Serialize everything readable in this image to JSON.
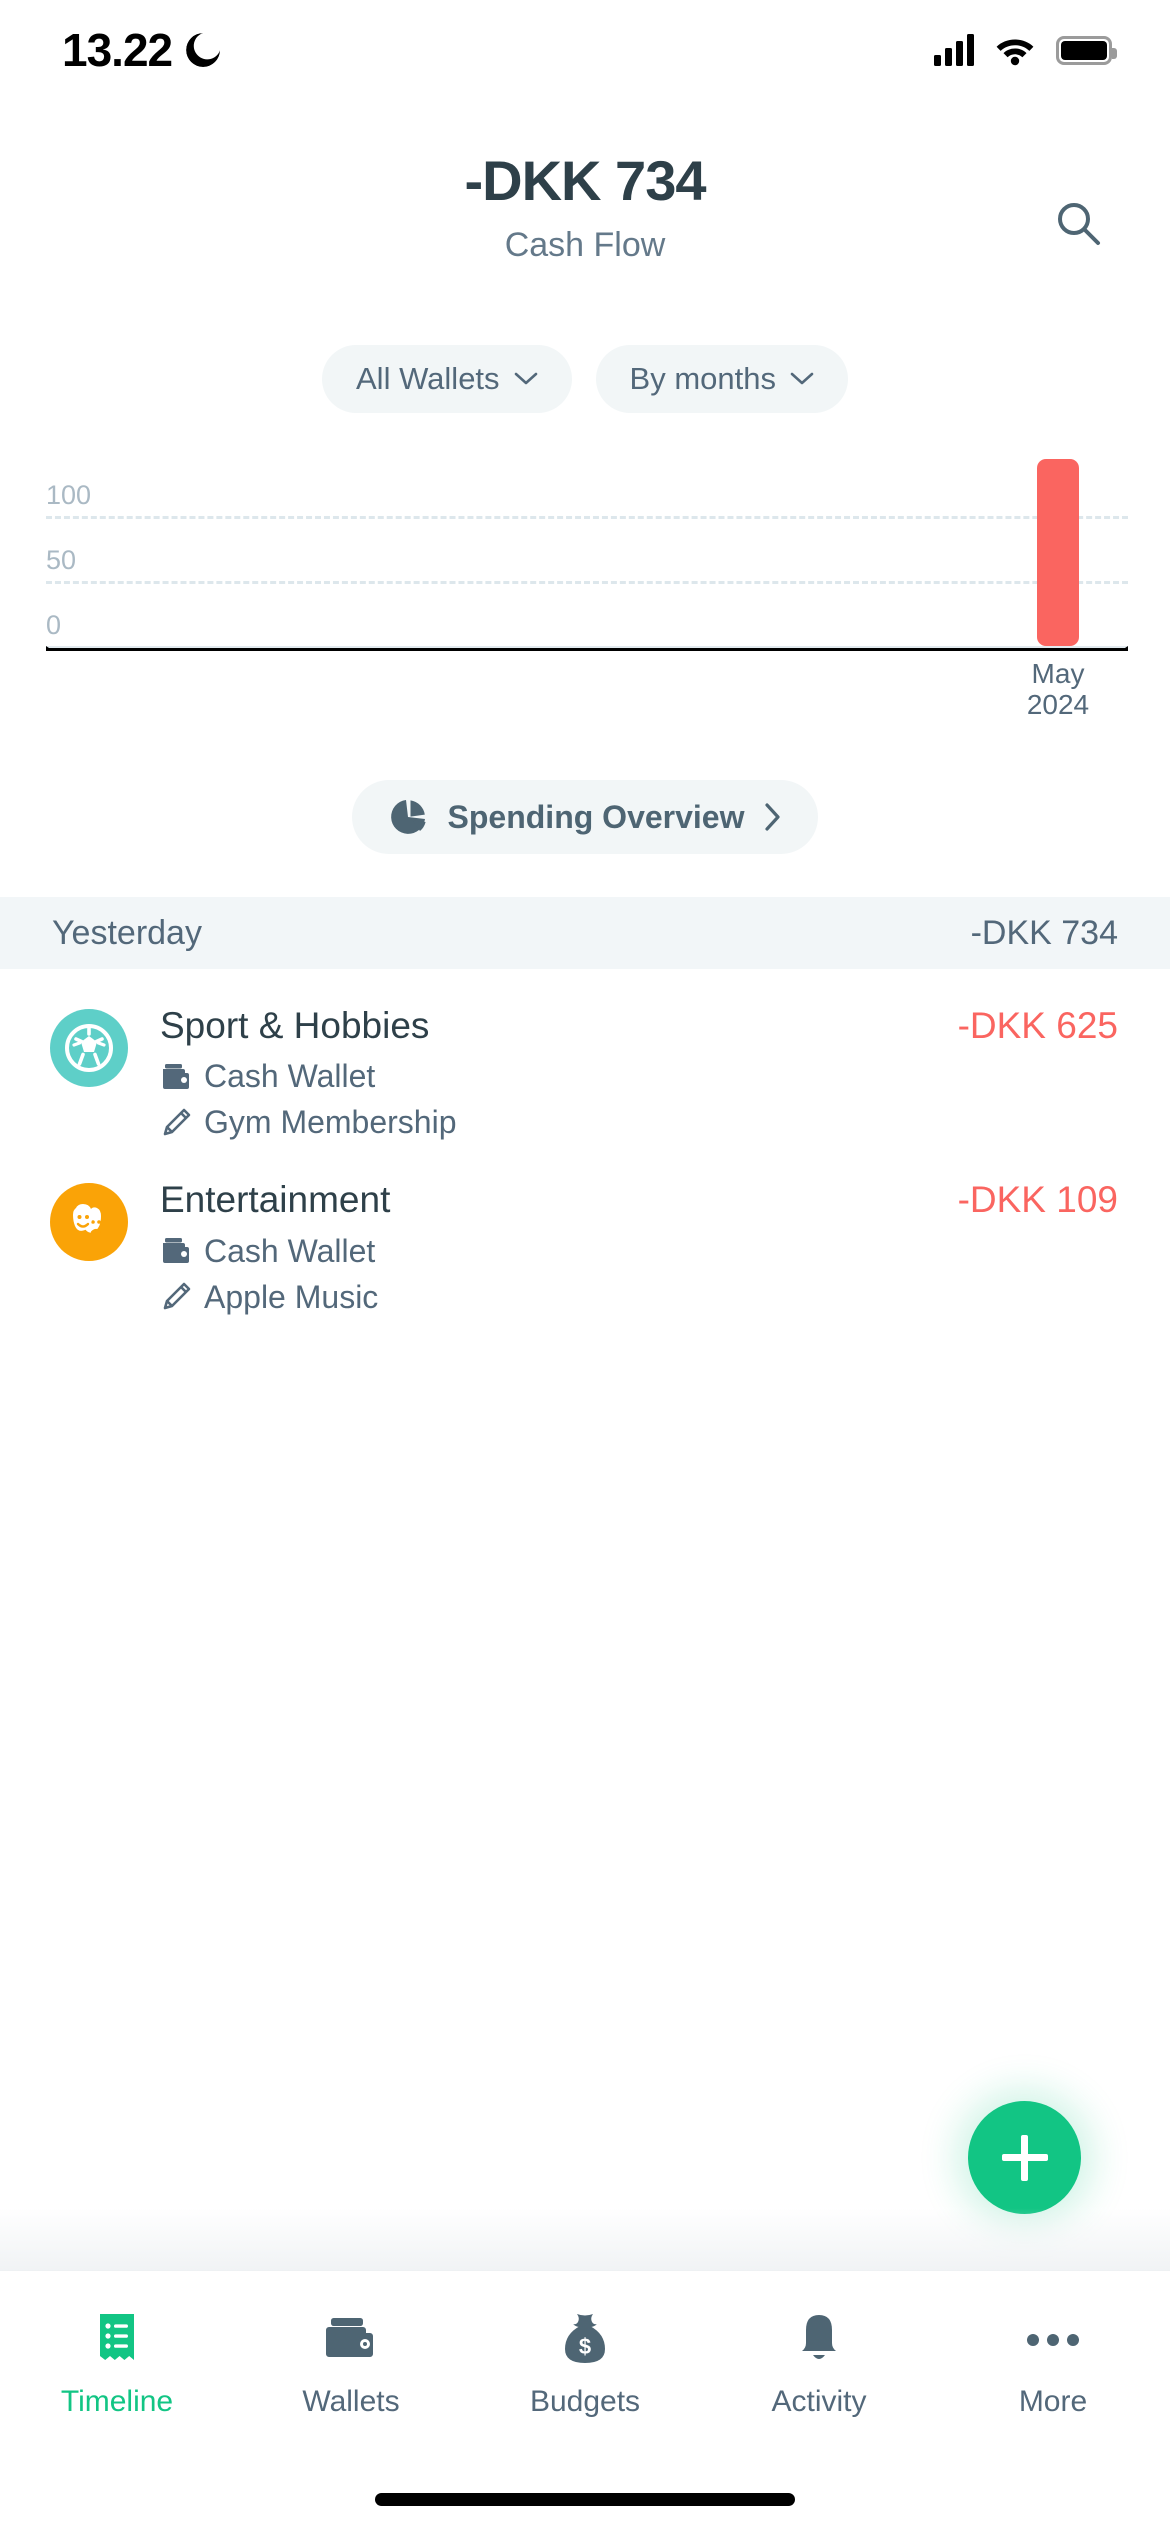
{
  "status_bar": {
    "time": "13.22",
    "dnd_icon": "moon-icon",
    "signal_icon": "cellular-signal-icon",
    "wifi_icon": "wifi-icon",
    "battery_icon": "battery-full-icon"
  },
  "header": {
    "amount": "-DKK 734",
    "subtitle": "Cash Flow",
    "search_icon": "search-icon"
  },
  "filters": [
    {
      "label": "All Wallets",
      "icon": "chevron-down-icon"
    },
    {
      "label": "By months",
      "icon": "chevron-down-icon"
    }
  ],
  "chart_data": {
    "type": "bar",
    "title": "",
    "categories": [
      "May 2024"
    ],
    "category_lines": [
      [
        "May",
        "2024"
      ]
    ],
    "values": [
      125
    ],
    "ylim": [
      0,
      125
    ],
    "yticks": [
      0,
      50,
      100
    ],
    "ytick_labels": [
      "0",
      "50",
      "100"
    ],
    "xlabel": "",
    "ylabel": "",
    "grid": true,
    "bar_color": "#fa6560",
    "legend": "none",
    "note": "Single bar for May 2024 representing DKK 734 spending; bar extends above the 100 gridline"
  },
  "spending_overview": {
    "label": "Spending Overview",
    "icon": "pie-chart-icon",
    "chevron": "chevron-right-icon"
  },
  "day_section": {
    "label": "Yesterday",
    "total": "-DKK 734"
  },
  "transactions": [
    {
      "category": "Sport & Hobbies",
      "wallet": "Cash Wallet",
      "note": "Gym Membership",
      "amount": "-DKK 625",
      "icon": "soccer-ball-icon",
      "icon_bg": "#5ecfc8",
      "wallet_icon": "wallet-icon",
      "note_icon": "pencil-icon"
    },
    {
      "category": "Entertainment",
      "wallet": "Cash Wallet",
      "note": "Apple Music",
      "amount": "-DKK 109",
      "icon": "theater-masks-icon",
      "icon_bg": "#faa307",
      "wallet_icon": "wallet-icon",
      "note_icon": "pencil-icon"
    }
  ],
  "fab": {
    "label": "+",
    "icon": "plus-icon",
    "color": "#12c584"
  },
  "tabs": [
    {
      "label": "Timeline",
      "icon": "receipt-list-icon",
      "active": true
    },
    {
      "label": "Wallets",
      "icon": "wallet-icon",
      "active": false
    },
    {
      "label": "Budgets",
      "icon": "money-bag-icon",
      "active": false
    },
    {
      "label": "Activity",
      "icon": "bell-icon",
      "active": false
    },
    {
      "label": "More",
      "icon": "ellipsis-icon",
      "active": false
    }
  ],
  "colors": {
    "accent": "#12c584",
    "negative": "#fa6560",
    "text_dark": "#2e4049",
    "text_muted": "#53687a",
    "chip_bg": "#f2f6f7"
  }
}
